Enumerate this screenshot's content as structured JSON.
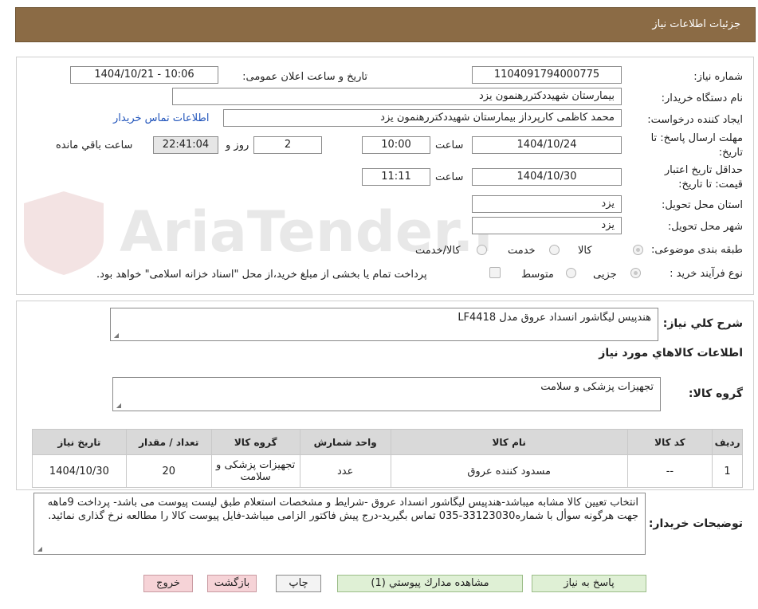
{
  "header": {
    "title": "جزئیات اطلاعات نیاز"
  },
  "labels": {
    "need_number": "شماره نیاز:",
    "announce_datetime": "تاریخ و ساعت اعلان عمومی:",
    "buyer_org": "نام دستگاه خریدار:",
    "requester": "ایجاد کننده درخواست:",
    "send_deadline_1": "مهلت ارسال پاسخ: تا",
    "send_deadline_2": "تاریخ:",
    "time": "ساعت",
    "day_and": "روز و",
    "remaining": "ساعت باقي مانده",
    "validity_1": "حداقل تاریخ اعتبار",
    "validity_2": "قیمت: تا تاریخ:",
    "province": "استان محل تحویل:",
    "city": "شهر محل تحویل:",
    "category": "طبقه بندی موضوعی:",
    "process": "نوع فرآیند خرید :",
    "general_desc": "شرح کلي نياز:",
    "goods_info": "اطلاعات کالاهاي مورد نياز",
    "goods_group": "گروه کالا:",
    "buyer_notes": "توضیحات خریدار:"
  },
  "values": {
    "need_number": "1104091794000775",
    "announce_datetime": "1404/10/21 - 10:06",
    "buyer_org": "بیمارستان شهیددکتررهنمون یزد",
    "requester": "محمد کاظمی کارپرداز بیمارستان شهیددکتررهنمون یزد",
    "contact_link": "اطلاعات تماس خریدار",
    "send_date": "1404/10/24",
    "send_time": "10:00",
    "days": "2",
    "remaining_time": "22:41:04",
    "validity_date": "1404/10/30",
    "validity_time": "11:11",
    "province": "یزد",
    "city": "یزد",
    "general_desc": "هندپیس لیگاشور انسداد عروق مدل LF4418",
    "goods_group": "تجهیزات پزشکی و سلامت",
    "buyer_notes": "انتخاب تعیین کالا مشابه میباشد-هندپیس لیگاشور انسداد عروق -شرایط و مشخصات استعلام طبق لیست پیوست می باشد- پرداخت 9ماهه جهت هرگونه سوأل با شماره33123030-035 تماس بگیرید-درج پیش فاکتور الزامی میباشد-فایل پیوست کالا را مطالعه نرخ گذاری نمائید."
  },
  "category_options": [
    {
      "label": "کالا",
      "selected": true
    },
    {
      "label": "خدمت",
      "selected": false
    },
    {
      "label": "کالا/خدمت",
      "selected": false
    }
  ],
  "process_options": [
    {
      "label": "جزیی",
      "selected": true
    },
    {
      "label": "متوسط",
      "selected": false
    }
  ],
  "treasury_checkbox_label": "پرداخت تمام یا بخشی از مبلغ خرید،از محل \"اسناد خزانه اسلامی\" خواهد بود.",
  "table": {
    "headers": [
      "رديف",
      "کد کالا",
      "نام کالا",
      "واحد شمارش",
      "گروه کالا",
      "تعداد / مقدار",
      "تاريخ نياز"
    ],
    "rows": [
      [
        "1",
        "--",
        "مسدود کننده عروق",
        "عدد",
        "تجهیزات پزشکی و سلامت",
        "20",
        "1404/10/30"
      ]
    ]
  },
  "buttons": {
    "reply": "پاسخ به نیاز",
    "attachments": "مشاهده مدارك پيوستي (1)",
    "print": "چاپ",
    "back": "بازگشت",
    "exit": "خروج"
  },
  "watermark": "AriaTender.neT",
  "colors": {
    "header": "#8b6b45",
    "link": "#2255bb",
    "reply_button": "#dff0d5",
    "back_button": "#f6d3d7"
  }
}
